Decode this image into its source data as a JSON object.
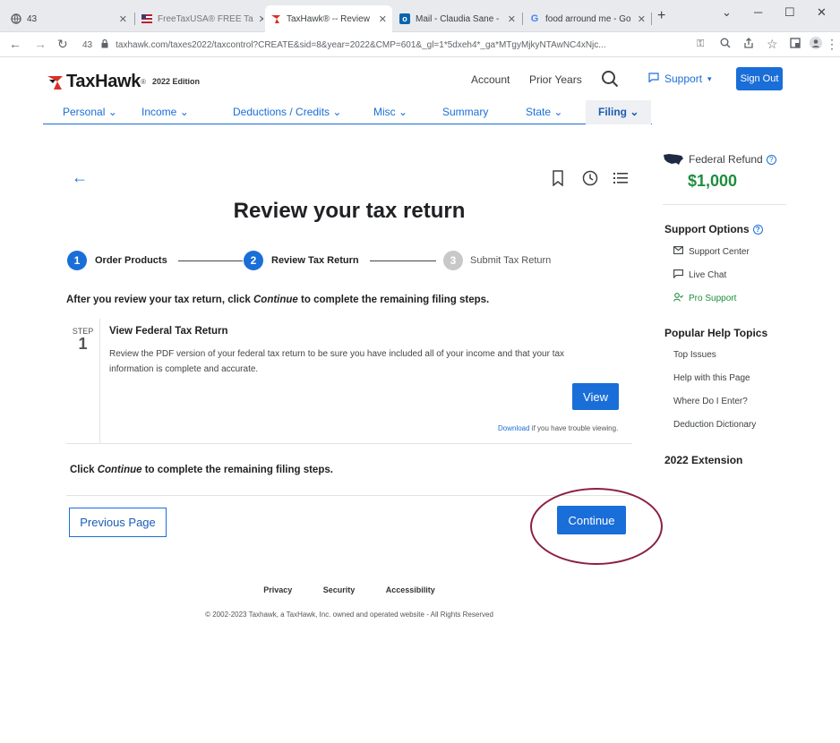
{
  "browser": {
    "tabs": [
      {
        "icon": "globe-icon",
        "label": "43"
      },
      {
        "icon": "flag-icon",
        "label": "FreeTaxUSA® FREE Ta"
      },
      {
        "icon": "taxhawk-icon",
        "label": "TaxHawk® -- Review"
      },
      {
        "icon": "outlook-icon",
        "label": "Mail - Claudia Sane -"
      },
      {
        "icon": "google-icon",
        "label": "food arround me - Go"
      }
    ],
    "new_tab": "+",
    "url_count": "43",
    "url": "taxhawk.com/taxes2022/taxcontrol?CREATE&sid=8&year=2022&CMP=601&_gl=1*5dxeh4*_ga*MTgyMjkyNTAwNC4xNjc..."
  },
  "header": {
    "brand": "TaxHawk",
    "brand_tm": "®",
    "edition": "2022 Edition",
    "links": [
      "Account",
      "Prior Years"
    ],
    "support": "Support",
    "signout": "Sign Out"
  },
  "nav": {
    "items": [
      "Personal",
      "Income",
      "Deductions / Credits",
      "Misc",
      "Summary",
      "State",
      "Filing"
    ]
  },
  "main": {
    "title": "Review your tax return",
    "steps": [
      {
        "num": "1",
        "label": "Order Products"
      },
      {
        "num": "2",
        "label": "Review Tax Return"
      },
      {
        "num": "3",
        "label": "Submit Tax Return"
      }
    ],
    "intro_before": "After you review your tax return, click ",
    "intro_em": "Continue",
    "intro_after": " to complete the remaining filing steps.",
    "step_box": {
      "word": "STEP",
      "digit": "1",
      "title": "View Federal Tax Return",
      "desc": "Review the PDF version of your federal tax return to be sure you have included all of your income and that your tax information is complete and accurate.",
      "view_label": "View",
      "download_link": "Download",
      "download_rest": " if you have trouble viewing."
    },
    "outro_before": "Click ",
    "outro_em": "Continue",
    "outro_after": " to complete the remaining filing steps.",
    "prev_label": "Previous Page",
    "continue_label": "Continue"
  },
  "footer": {
    "links": [
      "Privacy",
      "Security",
      "Accessibility"
    ],
    "copyright": "© 2002-2023 Taxhawk, a TaxHawk, Inc. owned and operated website - All Rights Reserved"
  },
  "sidebar": {
    "refund_label": "Federal Refund",
    "refund_amount": "$1,000",
    "support_heading": "Support Options",
    "support_items": [
      "Support Center",
      "Live Chat",
      "Pro Support"
    ],
    "help_heading": "Popular Help Topics",
    "help_items": [
      "Top Issues",
      "Help with this Page",
      "Where Do I Enter?",
      "Deduction Dictionary"
    ],
    "extension_heading": "2022 Extension"
  },
  "colors": {
    "accent": "#1a6ed8",
    "refund_green": "#1e8e3e",
    "annotation": "#8b1f3f"
  }
}
